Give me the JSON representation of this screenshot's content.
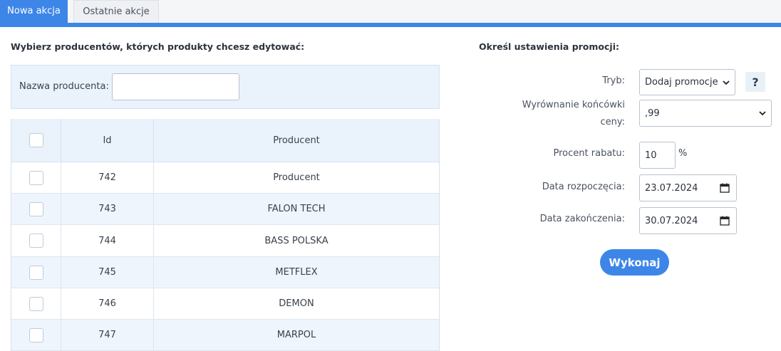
{
  "tabs": {
    "new_action": "Nowa akcja",
    "recent_actions": "Ostatnie akcje"
  },
  "left": {
    "heading": "Wybierz producentów, których produkty chcesz edytować:",
    "filter": {
      "label": "Nazwa producenta:",
      "value": "",
      "placeholder": ""
    },
    "table": {
      "headers": {
        "id": "Id",
        "producer": "Producent"
      },
      "rows": [
        {
          "id": "742",
          "producer": "Producent"
        },
        {
          "id": "743",
          "producer": "FALON TECH"
        },
        {
          "id": "744",
          "producer": "BASS POLSKA"
        },
        {
          "id": "745",
          "producer": "METFLEX"
        },
        {
          "id": "746",
          "producer": "DEMON"
        },
        {
          "id": "747",
          "producer": "MARPOL"
        }
      ]
    }
  },
  "right": {
    "heading": "Określ ustawienia promocji:",
    "mode": {
      "label": "Tryb:",
      "value": "Dodaj promocje"
    },
    "help": "?",
    "rounding": {
      "label_line1": "Wyrównanie końcówki",
      "label_line2": "ceny:",
      "value": ",99"
    },
    "discount": {
      "label": "Procent rabatu:",
      "value": "10",
      "unit": "%"
    },
    "start_date": {
      "label": "Data rozpoczęcia:",
      "value": "23.07.2024"
    },
    "end_date": {
      "label": "Data zakończenia:",
      "value": "30.07.2024"
    },
    "submit": "Wykonaj"
  },
  "colors": {
    "accent": "#3d86e8",
    "panel": "#eaf3fc",
    "row_alt": "#eef5fc"
  }
}
